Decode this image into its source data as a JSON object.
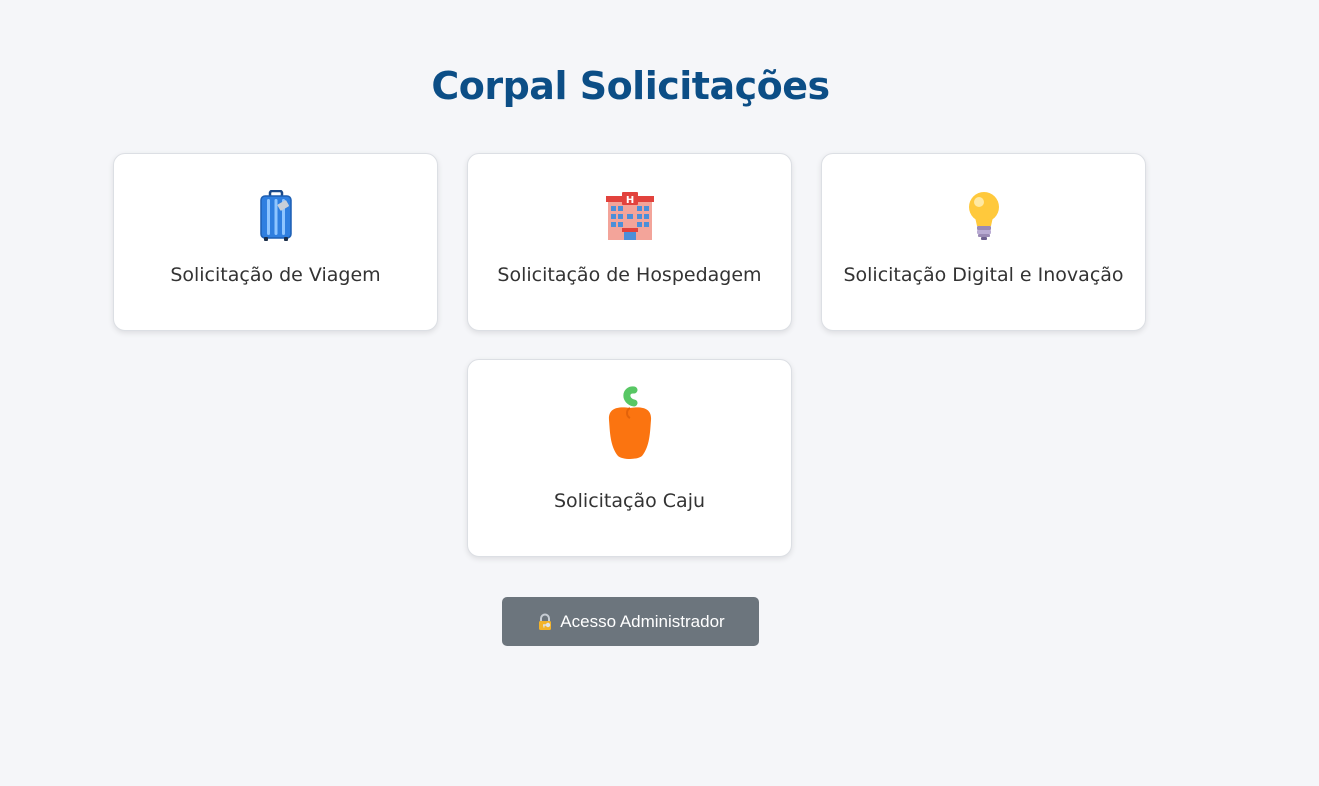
{
  "page": {
    "title": "Corpal Solicitações"
  },
  "cards": [
    {
      "label": "Solicitação de Viagem",
      "icon": "suitcase-icon"
    },
    {
      "label": "Solicitação de Hospedagem",
      "icon": "hotel-icon"
    },
    {
      "label": "Solicitação Digital e Inovação",
      "icon": "lightbulb-icon"
    },
    {
      "label": "Solicitação Caju",
      "icon": "bell-pepper-icon"
    }
  ],
  "admin_button": {
    "label": "Acesso Administrador",
    "icon": "lock-with-key-icon"
  },
  "colors": {
    "background": "#f5f6f9",
    "title": "#0c4e86",
    "admin_button": "#6c757d"
  }
}
